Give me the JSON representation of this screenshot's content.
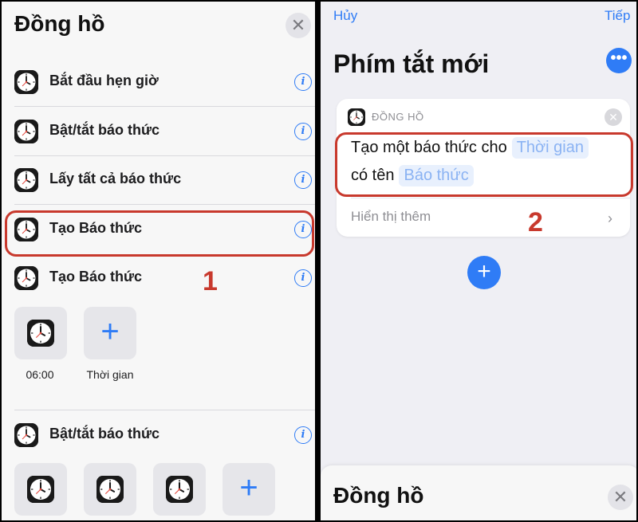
{
  "left": {
    "title": "Đồng hồ",
    "close_glyph": "✕",
    "actions": [
      {
        "label": "Bắt đầu hẹn giờ",
        "icon": "clock-icon"
      },
      {
        "label": "Bật/tắt báo thức",
        "icon": "clock-icon"
      },
      {
        "label": "Lấy tất cả báo thức",
        "icon": "clock-icon"
      },
      {
        "label": "Tạo Báo thức",
        "icon": "clock-icon",
        "highlighted": true
      },
      {
        "label": "Tạo Báo thức",
        "icon": "clock-icon"
      }
    ],
    "step_label": "1",
    "suggestions_1": [
      {
        "caption": "06:00",
        "icon": "clock-icon"
      },
      {
        "caption": "Thời gian",
        "icon": "plus-icon"
      }
    ],
    "section2": {
      "label": "Bật/tắt báo thức",
      "icon": "clock-icon"
    },
    "suggestions_2": [
      "clock-icon",
      "clock-icon",
      "clock-icon",
      "plus-icon"
    ]
  },
  "right": {
    "cancel_label": "Hủy",
    "next_label": "Tiếp",
    "title": "Phím tắt mới",
    "more_glyph": "•••",
    "card": {
      "app_label": "ĐỒNG HỒ",
      "line1_text": "Tạo một báo thức cho",
      "line1_token": "Thời gian",
      "line2_text": "có tên",
      "line2_token": "Báo thức",
      "show_more": "Hiển thị thêm",
      "chevron": "›"
    },
    "step_label": "2",
    "add_glyph": "+",
    "sheet_title": "Đồng hồ"
  },
  "colors": {
    "accent": "#2f7cf6",
    "annotation_red": "#c8392d",
    "token_bg": "#e8f0fd",
    "token_text": "#8bb3f3"
  }
}
